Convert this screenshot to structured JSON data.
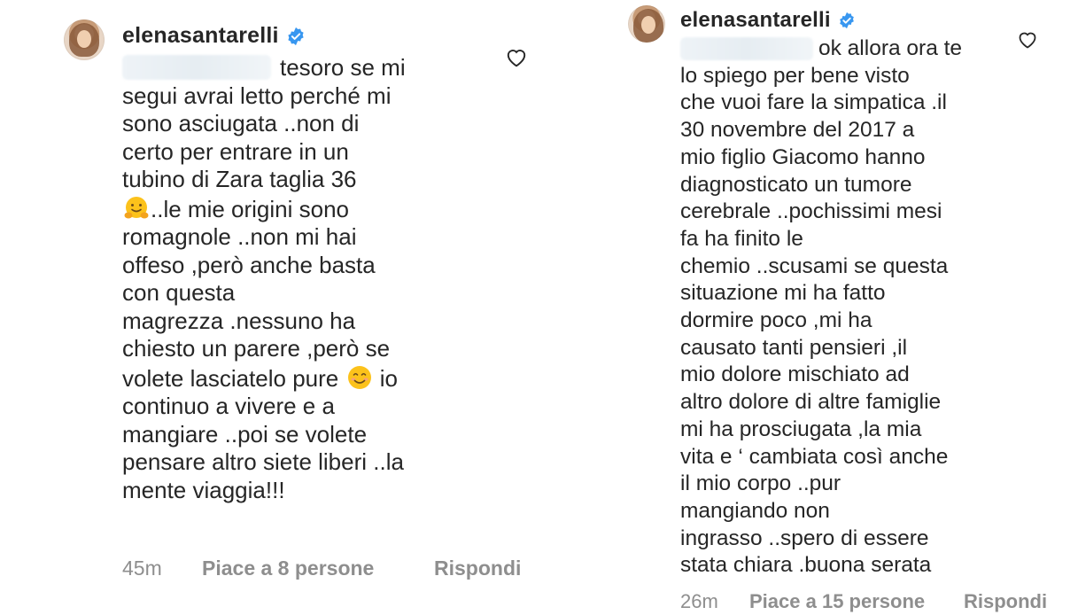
{
  "left": {
    "username": "elenasantarelli",
    "comment_lines": [
      "tesoro se mi",
      "segui avrai letto perché mi",
      "sono asciugata ..non di",
      "certo per entrare in un",
      "tubino di Zara taglia 36",
      "..le mie origini sono",
      "romagnole ..non mi hai",
      "offeso ,però anche basta",
      "con questa",
      "magrezza .nessuno ha",
      "chiesto un parere ,però se",
      "volete lasciatelo pure",
      "continuo a vivere e a",
      "mangiare ..poi se volete",
      "pensare altro siete liberi ..la",
      "mente viaggia!!!"
    ],
    "line12_tail": "io",
    "time": "45m",
    "likes": "Piace a 8 persone",
    "reply": "Rispondi"
  },
  "right": {
    "username": "elenasantarelli",
    "comment_lines": [
      "ok allora ora te",
      "lo spiego per bene visto",
      "che vuoi fare la simpatica .il",
      "30 novembre del 2017 a",
      "mio figlio Giacomo hanno",
      "diagnosticato un tumore",
      "cerebrale ..pochissimi mesi",
      "fa  ha finito le",
      "chemio ..scusami se questa",
      "situazione mi ha fatto",
      "dormire poco ,mi ha",
      "causato tanti pensieri ,il",
      "mio dolore mischiato ad",
      "altro dolore di altre famiglie",
      "mi ha prosciugata ,la mia",
      "vita e ‘ cambiata così anche",
      "il mio corpo ..pur",
      "mangiando non",
      "ingrasso ..spero di essere",
      "stata chiara .buona serata"
    ],
    "time": "26m",
    "likes": "Piace a 15 persone",
    "reply": "Rispondi"
  },
  "icons": {
    "verified": "verified-badge-icon",
    "heart": "heart-outline-icon",
    "hug": "hugging-face-emoji",
    "smile": "smiling-face-emoji"
  },
  "colors": {
    "text": "#262626",
    "muted": "#8e8e8e",
    "verified": "#3897f0"
  }
}
